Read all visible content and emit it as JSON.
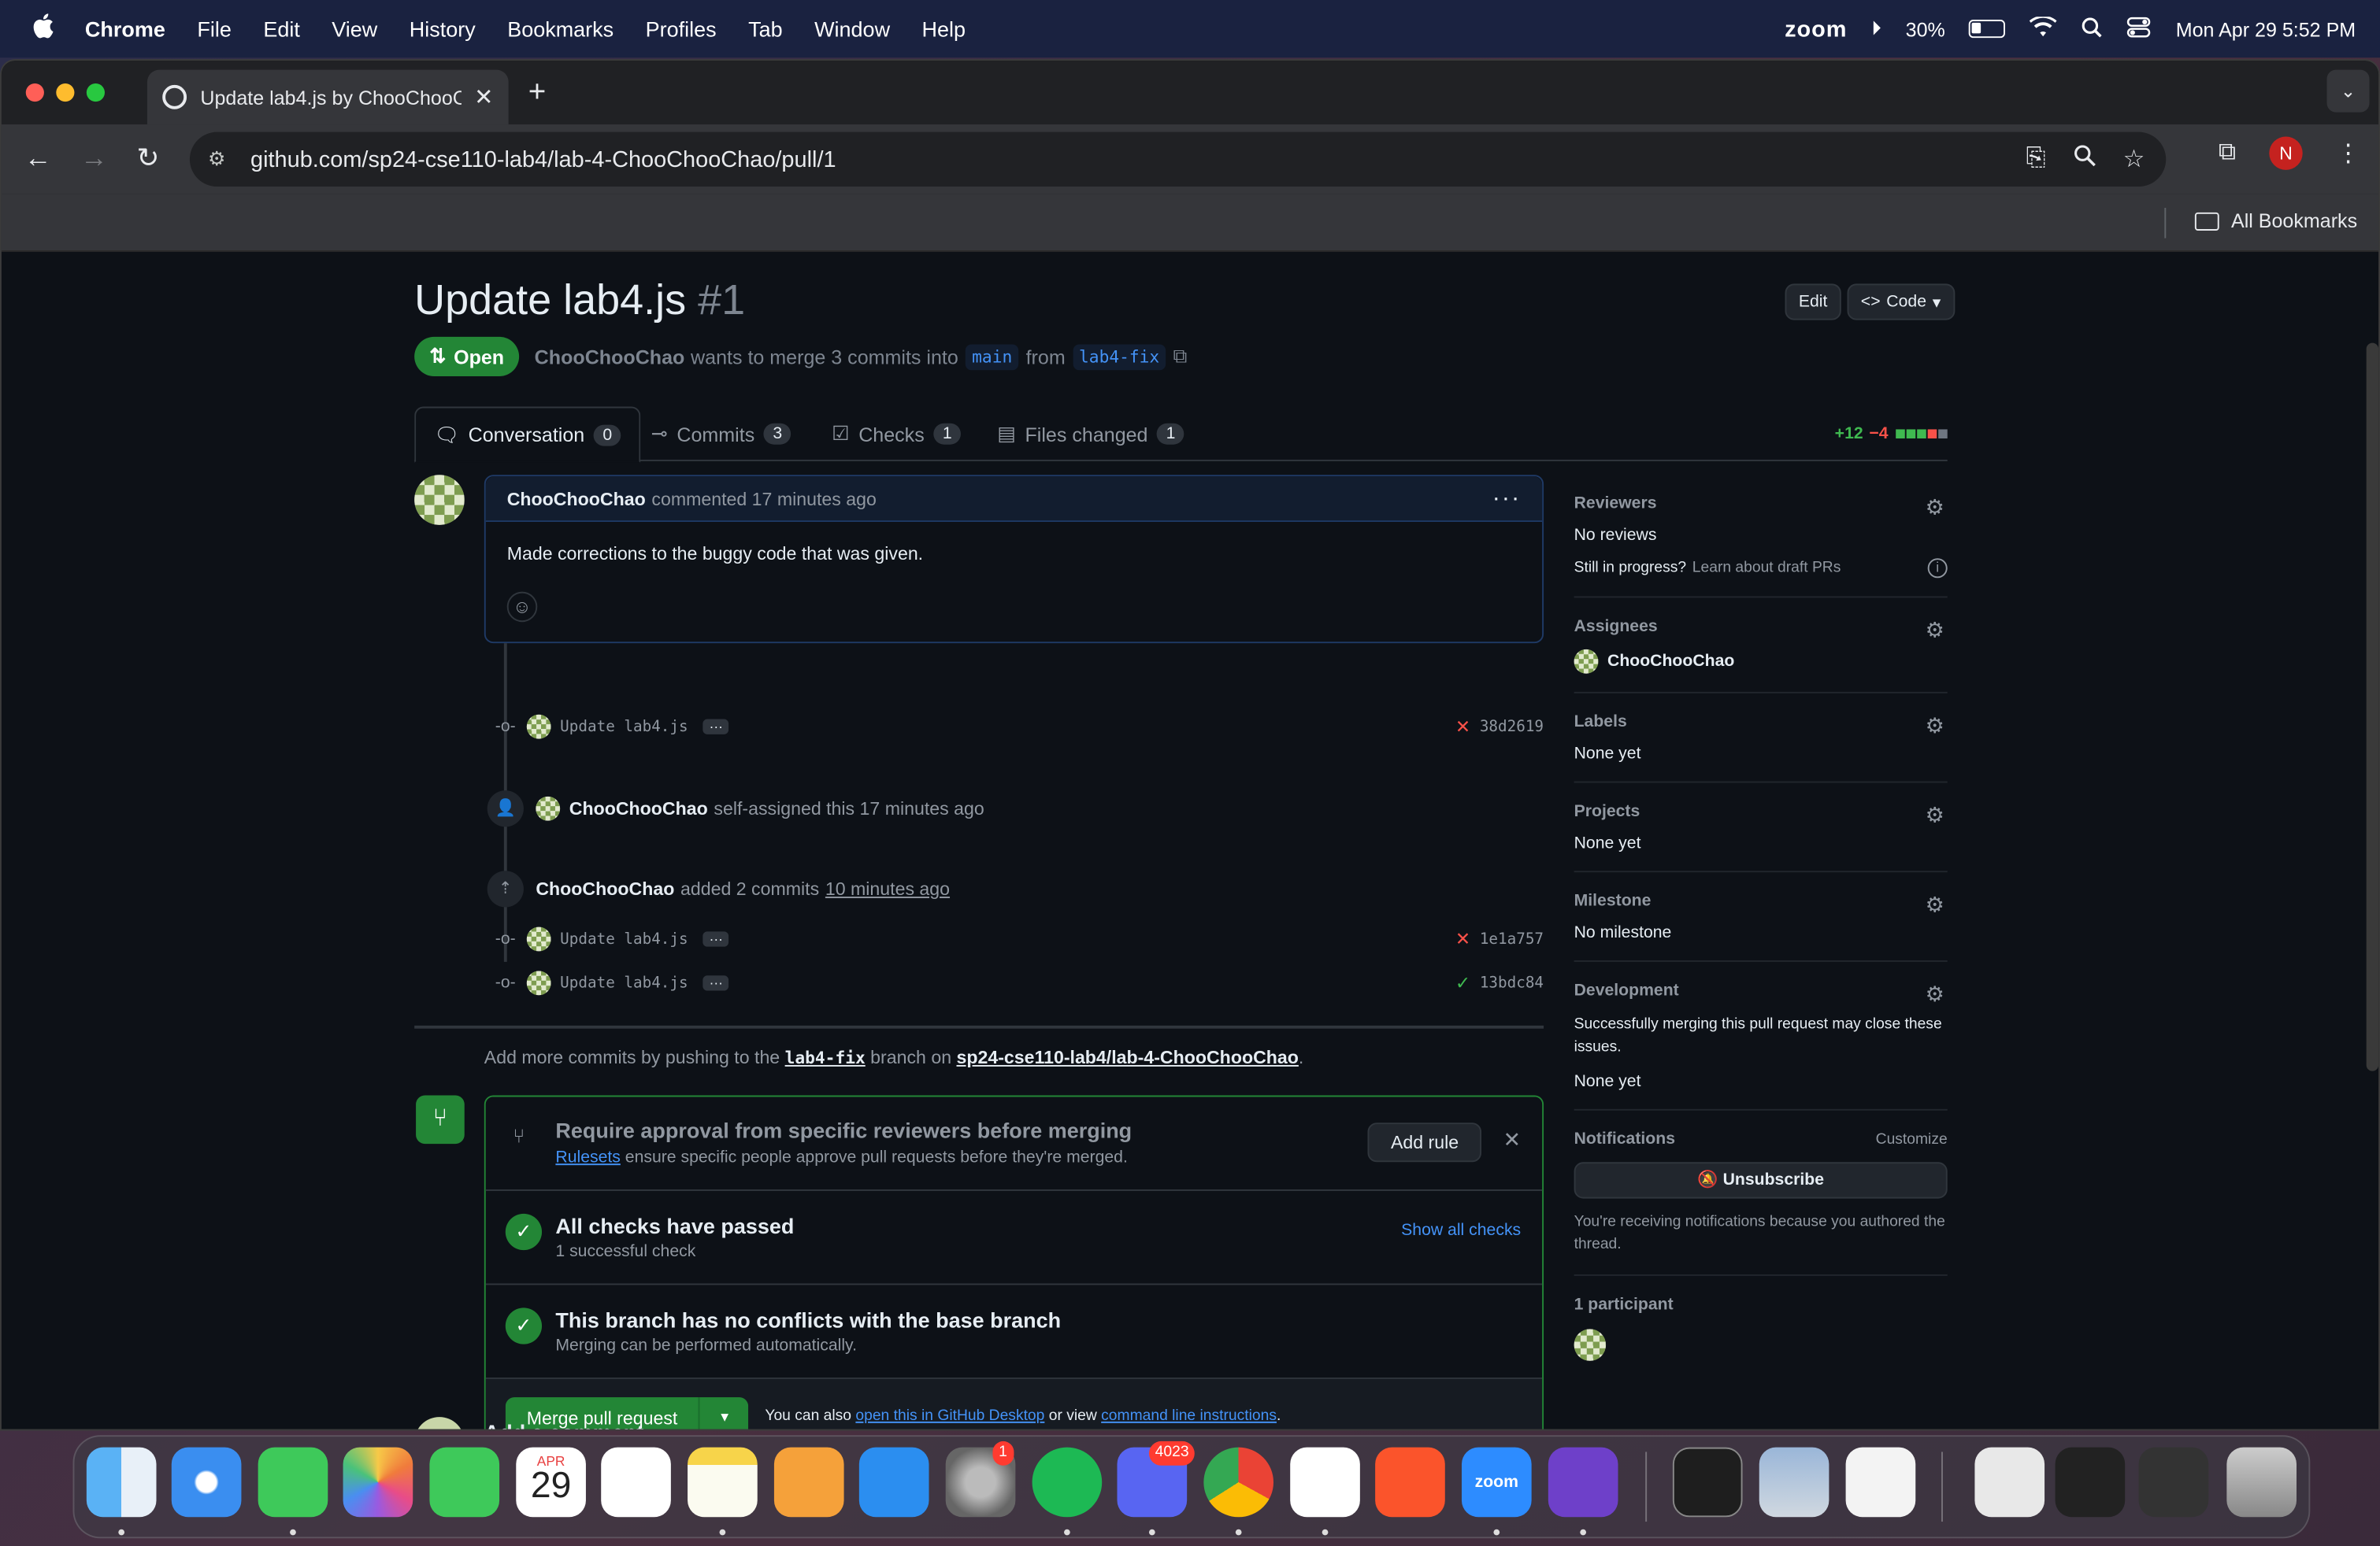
{
  "menubar": {
    "apple": "",
    "items": [
      "Chrome",
      "File",
      "Edit",
      "View",
      "History",
      "Bookmarks",
      "Profiles",
      "Tab",
      "Window",
      "Help"
    ],
    "zoom": "zoom",
    "battery": "30%",
    "datetime": "Mon Apr 29  5:52 PM"
  },
  "browser": {
    "tab_title": "Update lab4.js by ChooChooC",
    "url": "github.com/sp24-cse110-lab4/lab-4-ChooChooChao/pull/1",
    "profile_initial": "N",
    "bookmarks_label": "All Bookmarks"
  },
  "pr": {
    "title": "Update lab4.js",
    "number": "#1",
    "edit_label": "Edit",
    "code_label": "Code",
    "state": "Open",
    "author": "ChooChooChao",
    "merge_text": "wants to merge 3 commits into",
    "base": "main",
    "from_text": "from",
    "head": "lab4-fix",
    "tabs": [
      {
        "label": "Conversation",
        "count": "0"
      },
      {
        "label": "Commits",
        "count": "3"
      },
      {
        "label": "Checks",
        "count": "1"
      },
      {
        "label": "Files changed",
        "count": "1"
      }
    ],
    "additions": "+12",
    "deletions": "−4"
  },
  "comment": {
    "author": "ChooChooChao",
    "meta": "commented 17 minutes ago",
    "body": "Made corrections to the buggy code that was given."
  },
  "timeline": {
    "commit1": {
      "msg": "Update lab4.js",
      "sha": "38d2619",
      "status": "fail"
    },
    "assign": {
      "author": "ChooChooChao",
      "text": "self-assigned this 17 minutes ago"
    },
    "added": {
      "author": "ChooChooChao",
      "text": "added 2 commits",
      "time": "10 minutes ago"
    },
    "commit2": {
      "msg": "Update lab4.js",
      "sha": "1e1a757",
      "status": "fail"
    },
    "commit3": {
      "msg": "Update lab4.js",
      "sha": "13bdc84",
      "status": "pass"
    },
    "push_prefix": "Add more commits by pushing to the",
    "push_branch": "lab4-fix",
    "push_mid": "branch on",
    "push_repo": "sp24-cse110-lab4/lab-4-ChooChooChao",
    "push_end": "."
  },
  "mergebox": {
    "rule_title": "Require approval from specific reviewers before merging",
    "rule_link": "Rulesets",
    "rule_sub": "ensure specific people approve pull requests before they're merged.",
    "add_rule": "Add rule",
    "checks_title": "All checks have passed",
    "checks_sub": "1 successful check",
    "show_all": "Show all checks",
    "conflict_title": "This branch has no conflicts with the base branch",
    "conflict_sub": "Merging can be performed automatically.",
    "merge_label": "Merge pull request",
    "note_prefix": "You can also",
    "note_link1": "open this in GitHub Desktop",
    "note_mid": "or view",
    "note_link2": "command line instructions",
    "note_end": "."
  },
  "add_comment": "Add a comment",
  "sidebar": {
    "reviewers": {
      "heading": "Reviewers",
      "value": "No reviews",
      "draft_q": "Still in progress?",
      "draft_link": "Learn about draft PRs"
    },
    "assignees": {
      "heading": "Assignees",
      "value": "ChooChooChao"
    },
    "labels": {
      "heading": "Labels",
      "value": "None yet"
    },
    "projects": {
      "heading": "Projects",
      "value": "None yet"
    },
    "milestone": {
      "heading": "Milestone",
      "value": "No milestone"
    },
    "development": {
      "heading": "Development",
      "text": "Successfully merging this pull request may close these issues.",
      "value": "None yet"
    },
    "notifications": {
      "heading": "Notifications",
      "customize": "Customize",
      "button": "Unsubscribe",
      "note": "You're receiving notifications because you authored the thread."
    },
    "participants": {
      "heading": "1 participant"
    }
  },
  "dock": {
    "calendar_month": "APR",
    "calendar_day": "29",
    "settings_badge": "1",
    "discord_badge": "4023",
    "zoom_label": "zoom"
  }
}
